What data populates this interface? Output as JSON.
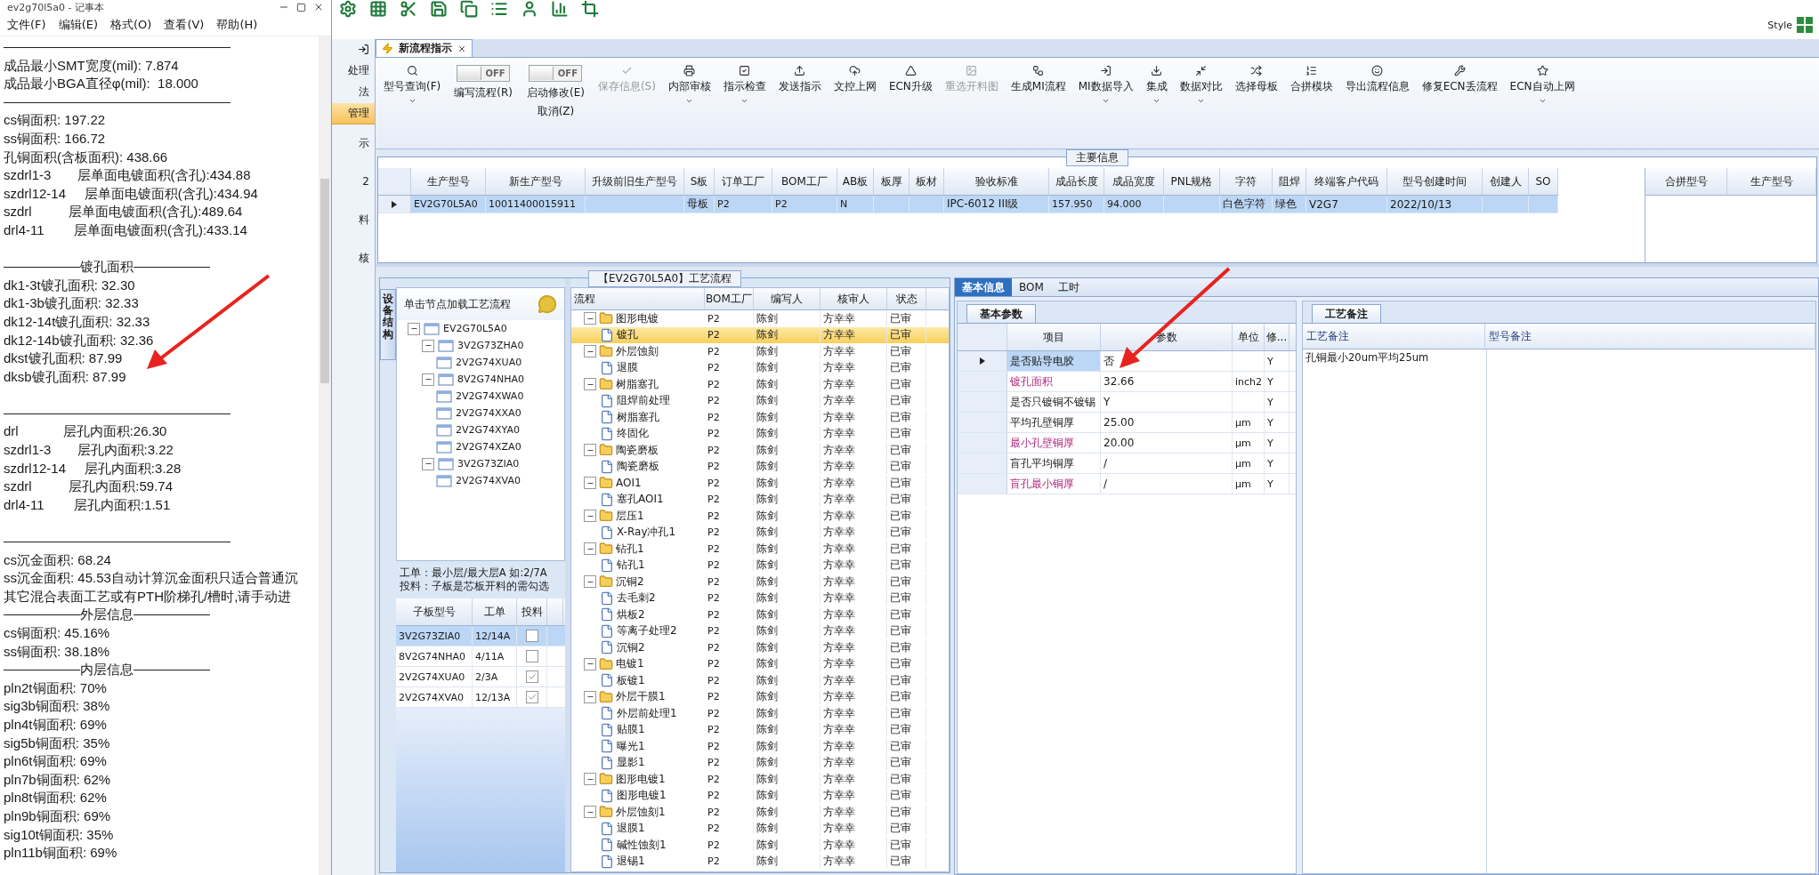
{
  "notepad": {
    "title": "ev2g70l5a0 - 记事本",
    "menu": [
      "文件(F)",
      "编辑(E)",
      "格式(O)",
      "查看(V)",
      "帮助(H)"
    ],
    "lines": [
      {
        "kind": "rule"
      },
      {
        "kind": "text",
        "text": "成品最小SMT宽度(mil): 7.874"
      },
      {
        "kind": "text",
        "text": "成品最小BGA直径φ(mil):  18.000"
      },
      {
        "kind": "rule"
      },
      {
        "kind": "text",
        "text": "cs铜面积: 197.22"
      },
      {
        "kind": "text",
        "text": "ss铜面积: 166.72"
      },
      {
        "kind": "text",
        "text": "孔铜面积(含板面积): 438.66"
      },
      {
        "kind": "text",
        "text": "szdrl1-3       层单面电镀面积(含孔):434.88"
      },
      {
        "kind": "text",
        "text": "szdrl12-14     层单面电镀面积(含孔):434.94"
      },
      {
        "kind": "text",
        "text": "szdrl          层单面电镀面积(含孔):489.64"
      },
      {
        "kind": "text",
        "text": "drl4-11        层单面电镀面积(含孔):433.14"
      },
      {
        "kind": "blank"
      },
      {
        "kind": "titled_rule",
        "text": "镀孔面积"
      },
      {
        "kind": "text",
        "text": "dk1-3t镀孔面积: 32.30"
      },
      {
        "kind": "text",
        "text": "dk1-3b镀孔面积: 32.33"
      },
      {
        "kind": "text",
        "text": "dk12-14t镀孔面积: 32.33"
      },
      {
        "kind": "text",
        "text": "dk12-14b镀孔面积: 32.36"
      },
      {
        "kind": "text",
        "text": "dkst镀孔面积: 87.99"
      },
      {
        "kind": "text",
        "text": "dksb镀孔面积: 87.99"
      },
      {
        "kind": "blank"
      },
      {
        "kind": "rule"
      },
      {
        "kind": "text",
        "text": "drl            层孔内面积:26.30"
      },
      {
        "kind": "text",
        "text": "szdrl1-3       层孔内面积:3.22"
      },
      {
        "kind": "text",
        "text": "szdrl12-14     层孔内面积:3.28"
      },
      {
        "kind": "text",
        "text": "szdrl          层孔内面积:59.74"
      },
      {
        "kind": "text",
        "text": "drl4-11        层孔内面积:1.51"
      },
      {
        "kind": "blank"
      },
      {
        "kind": "rule"
      },
      {
        "kind": "text",
        "text": "cs沉金面积: 68.24"
      },
      {
        "kind": "text",
        "text": "ss沉金面积: 45.53自动计算沉金面积只适合普通沉"
      },
      {
        "kind": "text",
        "text": "其它混合表面工艺或有PTH阶梯孔/槽时,请手动进"
      },
      {
        "kind": "titled_rule",
        "text": "外层信息"
      },
      {
        "kind": "text",
        "text": "cs铜面积: 45.16%"
      },
      {
        "kind": "text",
        "text": "ss铜面积: 38.18%"
      },
      {
        "kind": "titled_rule",
        "text": "内层信息"
      },
      {
        "kind": "text",
        "text": "pln2t铜面积: 70%"
      },
      {
        "kind": "text",
        "text": "sig3b铜面积: 38%"
      },
      {
        "kind": "text",
        "text": "pln4t铜面积: 69%"
      },
      {
        "kind": "text",
        "text": "sig5b铜面积: 35%"
      },
      {
        "kind": "text",
        "text": "pln6t铜面积: 69%"
      },
      {
        "kind": "text",
        "text": "pln7b铜面积: 62%"
      },
      {
        "kind": "text",
        "text": "pln8t铜面积: 62%"
      },
      {
        "kind": "text",
        "text": "pln9b铜面积: 69%"
      },
      {
        "kind": "text",
        "text": "sig10t铜面积: 35%"
      },
      {
        "kind": "text",
        "text": "pln11b铜面积: 69%"
      }
    ]
  },
  "app": {
    "top_bar": {
      "style_label": "Style"
    },
    "sidebar": [
      {
        "label": "处理",
        "selected": false
      },
      {
        "label": "法",
        "selected": false
      },
      {
        "label": "管理",
        "selected": true
      },
      {
        "label": "示",
        "selected": false
      },
      {
        "label": "2",
        "selected": false
      },
      {
        "label": "料",
        "selected": false
      },
      {
        "label": "核",
        "selected": false
      }
    ],
    "tab": {
      "label": "新流程指示",
      "selected": true
    },
    "ribbon": [
      {
        "kind": "button",
        "label": "型号查询(F)",
        "dropdown": true,
        "disabled": false
      },
      {
        "kind": "toggle",
        "label": "编写流程(R)",
        "state_text": "OFF",
        "on": false
      },
      {
        "kind": "toggle",
        "label": "启动修改(E)",
        "sublabel": "取消(Z)",
        "state_text": "OFF",
        "on": false
      },
      {
        "kind": "button",
        "label": "保存信息(S)",
        "dropdown": false,
        "disabled": true
      },
      {
        "kind": "button",
        "label": "内部审核",
        "dropdown": true,
        "disabled": false
      },
      {
        "kind": "button",
        "label": "指示检查",
        "dropdown": true,
        "disabled": false
      },
      {
        "kind": "button",
        "label": "发送指示",
        "dropdown": false,
        "disabled": false
      },
      {
        "kind": "button",
        "label": "文控上网",
        "dropdown": false,
        "disabled": false
      },
      {
        "kind": "button",
        "label": "ECN升级",
        "dropdown": false,
        "disabled": false
      },
      {
        "kind": "button",
        "label": "重选开料图",
        "dropdown": false,
        "disabled": true
      },
      {
        "kind": "button",
        "label": "生成MI流程",
        "dropdown": false,
        "disabled": false
      },
      {
        "kind": "button",
        "label": "MI数据导入",
        "dropdown": true,
        "disabled": false
      },
      {
        "kind": "button",
        "label": "集成",
        "dropdown": true,
        "disabled": false
      },
      {
        "kind": "button",
        "label": "数据对比",
        "dropdown": true,
        "disabled": false
      },
      {
        "kind": "button",
        "label": "选择母板",
        "dropdown": false,
        "disabled": false
      },
      {
        "kind": "button",
        "label": "合拼模块",
        "dropdown": false,
        "disabled": false
      },
      {
        "kind": "button",
        "label": "导出流程信息",
        "dropdown": false,
        "disabled": false
      },
      {
        "kind": "button",
        "label": "修复ECN丢流程",
        "dropdown": false,
        "disabled": false
      },
      {
        "kind": "button",
        "label": "ECN自动上网",
        "dropdown": true,
        "disabled": false
      }
    ],
    "main_info": {
      "title": "主要信息",
      "columns": [
        "生产型号",
        "新生产型号",
        "升级前旧生产型号",
        "S板",
        "订单工厂",
        "BOM工厂",
        "AB板",
        "板厚",
        "板材",
        "验收标准",
        "成品长度",
        "成品宽度",
        "PNL规格",
        "字符",
        "阻焊",
        "终端客户代码",
        "型号创建时间",
        "创建人",
        "SO"
      ],
      "rows": [
        {
          "current": true,
          "selected": true,
          "cells": [
            "EV2G70L5A0",
            "10011400015911",
            null,
            "母板",
            "P2",
            "P2",
            "N",
            null,
            null,
            "IPC-6012 III级",
            "157.950",
            "94.000",
            null,
            "白色字符",
            "绿色",
            "V2G7",
            "2022/10/13",
            null,
            null
          ]
        }
      ],
      "merge_columns": [
        "合拼型号",
        "生产型号"
      ]
    },
    "process": {
      "title": "【EV2G70L5A0】工艺流程",
      "side_tab": "设备结构",
      "tree_hint": "单击节点加载工艺流程",
      "tree": {
        "label": "EV2G70L5A0",
        "expanded": true,
        "children": [
          {
            "label": "3V2G73ZHA0",
            "expanded": true,
            "children": [
              {
                "label": "2V2G74XUA0"
              }
            ]
          },
          {
            "label": "8V2G74NHA0",
            "expanded": true,
            "children": [
              {
                "label": "2V2G74XWA0"
              },
              {
                "label": "2V2G74XXA0"
              },
              {
                "label": "2V2G74XYA0"
              },
              {
                "label": "2V2G74XZA0"
              }
            ]
          },
          {
            "label": "3V2G73ZIA0",
            "expanded": true,
            "children": [
              {
                "label": "2V2G74XVA0"
              }
            ]
          }
        ]
      },
      "notes": [
        "工单：最小层/最大层A 如:2/7A",
        "投料：子板是芯板开料的需勾选"
      ],
      "sub_grid": {
        "columns": [
          "子板型号",
          "工单",
          "投料"
        ],
        "rows": [
          {
            "cells": [
              "3V2G73ZIA0",
              "12/14A"
            ],
            "checked": false,
            "selected": true
          },
          {
            "cells": [
              "8V2G74NHA0",
              "4/11A"
            ],
            "checked": false,
            "selected": false
          },
          {
            "cells": [
              "2V2G74XUA0",
              "2/3A"
            ],
            "checked": true,
            "selected": false
          },
          {
            "cells": [
              "2V2G74XVA0",
              "12/13A"
            ],
            "checked": true,
            "selected": false
          }
        ]
      },
      "flow_grid": {
        "columns": [
          "流程",
          "BOM工厂",
          "编写人",
          "核审人",
          "状态"
        ],
        "rows": [
          {
            "name": "图形电镀",
            "bom": "P2",
            "writer": "陈剑",
            "reviewer": "方幸幸",
            "status": "已审",
            "selected": false,
            "expanded": true,
            "children": [
              {
                "name": "镀孔",
                "bom": "P2",
                "writer": "陈剑",
                "reviewer": "方幸幸",
                "status": "已审",
                "selected": true
              }
            ]
          },
          {
            "name": "外层蚀刻",
            "bom": "P2",
            "writer": "陈剑",
            "reviewer": "方幸幸",
            "status": "已审",
            "selected": false,
            "expanded": true,
            "children": [
              {
                "name": "退膜",
                "bom": "P2",
                "writer": "陈剑",
                "reviewer": "方幸幸",
                "status": "已审",
                "selected": false
              }
            ]
          },
          {
            "name": "树脂塞孔",
            "bom": "P2",
            "writer": "陈剑",
            "reviewer": "方幸幸",
            "status": "已审",
            "selected": false,
            "expanded": true,
            "children": [
              {
                "name": "阻焊前处理",
                "bom": "P2",
                "writer": "陈剑",
                "reviewer": "方幸幸",
                "status": "已审",
                "selected": false
              },
              {
                "name": "树脂塞孔",
                "bom": "P2",
                "writer": "陈剑",
                "reviewer": "方幸幸",
                "status": "已审",
                "selected": false
              },
              {
                "name": "终固化",
                "bom": "P2",
                "writer": "陈剑",
                "reviewer": "方幸幸",
                "status": "已审",
                "selected": false
              }
            ]
          },
          {
            "name": "陶瓷磨板",
            "bom": "P2",
            "writer": "陈剑",
            "reviewer": "方幸幸",
            "status": "已审",
            "selected": false,
            "expanded": true,
            "children": [
              {
                "name": "陶瓷磨板",
                "bom": "P2",
                "writer": "陈剑",
                "reviewer": "方幸幸",
                "status": "已审",
                "selected": false
              }
            ]
          },
          {
            "name": "AOI1",
            "bom": "P2",
            "writer": "陈剑",
            "reviewer": "方幸幸",
            "status": "已审",
            "selected": false,
            "expanded": true,
            "children": [
              {
                "name": "塞孔AOI1",
                "bom": "P2",
                "writer": "陈剑",
                "reviewer": "方幸幸",
                "status": "已审",
                "selected": false
              }
            ]
          },
          {
            "name": "层压1",
            "bom": "P2",
            "writer": "陈剑",
            "reviewer": "方幸幸",
            "status": "已审",
            "selected": false,
            "expanded": true,
            "children": [
              {
                "name": "X-Ray冲孔1",
                "bom": "P2",
                "writer": "陈剑",
                "reviewer": "方幸幸",
                "status": "已审",
                "selected": false
              }
            ]
          },
          {
            "name": "钻孔1",
            "bom": "P2",
            "writer": "陈剑",
            "reviewer": "方幸幸",
            "status": "已审",
            "selected": false,
            "expanded": true,
            "children": [
              {
                "name": "钻孔1",
                "bom": "P2",
                "writer": "陈剑",
                "reviewer": "方幸幸",
                "status": "已审",
                "selected": false
              }
            ]
          },
          {
            "name": "沉铜2",
            "bom": "P2",
            "writer": "陈剑",
            "reviewer": "方幸幸",
            "status": "已审",
            "selected": false,
            "expanded": true,
            "children": [
              {
                "name": "去毛刺2",
                "bom": "P2",
                "writer": "陈剑",
                "reviewer": "方幸幸",
                "status": "已审",
                "selected": false
              },
              {
                "name": "烘板2",
                "bom": "P2",
                "writer": "陈剑",
                "reviewer": "方幸幸",
                "status": "已审",
                "selected": false
              },
              {
                "name": "等离子处理2",
                "bom": "P2",
                "writer": "陈剑",
                "reviewer": "方幸幸",
                "status": "已审",
                "selected": false
              },
              {
                "name": "沉铜2",
                "bom": "P2",
                "writer": "陈剑",
                "reviewer": "方幸幸",
                "status": "已审",
                "selected": false
              }
            ]
          },
          {
            "name": "电镀1",
            "bom": "P2",
            "writer": "陈剑",
            "reviewer": "方幸幸",
            "status": "已审",
            "selected": false,
            "expanded": true,
            "children": [
              {
                "name": "板镀1",
                "bom": "P2",
                "writer": "陈剑",
                "reviewer": "方幸幸",
                "status": "已审",
                "selected": false
              }
            ]
          },
          {
            "name": "外层干膜1",
            "bom": "P2",
            "writer": "陈剑",
            "reviewer": "方幸幸",
            "status": "已审",
            "selected": false,
            "expanded": true,
            "children": [
              {
                "name": "外层前处理1",
                "bom": "P2",
                "writer": "陈剑",
                "reviewer": "方幸幸",
                "status": "已审",
                "selected": false
              },
              {
                "name": "贴膜1",
                "bom": "P2",
                "writer": "陈剑",
                "reviewer": "方幸幸",
                "status": "已审",
                "selected": false
              },
              {
                "name": "曝光1",
                "bom": "P2",
                "writer": "陈剑",
                "reviewer": "方幸幸",
                "status": "已审",
                "selected": false
              },
              {
                "name": "显影1",
                "bom": "P2",
                "writer": "陈剑",
                "reviewer": "方幸幸",
                "status": "已审",
                "selected": false
              }
            ]
          },
          {
            "name": "图形电镀1",
            "bom": "P2",
            "writer": "陈剑",
            "reviewer": "方幸幸",
            "status": "已审",
            "selected": false,
            "expanded": true,
            "children": [
              {
                "name": "图形电镀1",
                "bom": "P2",
                "writer": "陈剑",
                "reviewer": "方幸幸",
                "status": "已审",
                "selected": false
              }
            ]
          },
          {
            "name": "外层蚀刻1",
            "bom": "P2",
            "writer": "陈剑",
            "reviewer": "方幸幸",
            "status": "已审",
            "selected": false,
            "expanded": true,
            "children": [
              {
                "name": "退膜1",
                "bom": "P2",
                "writer": "陈剑",
                "reviewer": "方幸幸",
                "status": "已审",
                "selected": false
              },
              {
                "name": "碱性蚀刻1",
                "bom": "P2",
                "writer": "陈剑",
                "reviewer": "方幸幸",
                "status": "已审",
                "selected": false
              },
              {
                "name": "退锡1",
                "bom": "P2",
                "writer": "陈剑",
                "reviewer": "方幸幸",
                "status": "已审",
                "selected": false
              }
            ]
          }
        ]
      }
    },
    "detail": {
      "tabs": [
        {
          "label": "基本信息",
          "selected": true
        },
        {
          "label": "BOM",
          "selected": false
        },
        {
          "label": "工时",
          "selected": false
        }
      ],
      "params": {
        "tab": "基本参数",
        "columns": [
          "项目",
          "参数",
          "单位",
          "修..."
        ],
        "rows": [
          {
            "current": true,
            "highlighted": false,
            "cells": [
              "是否贴导电胶",
              "否",
              null,
              "Y"
            ]
          },
          {
            "current": false,
            "highlighted": true,
            "cells": [
              "镀孔面积",
              "32.66",
              "inch2",
              "Y"
            ]
          },
          {
            "current": false,
            "highlighted": false,
            "cells": [
              "是否只镀铜不镀锡",
              "Y",
              null,
              "Y"
            ]
          },
          {
            "current": false,
            "highlighted": false,
            "cells": [
              "平均孔壁铜厚",
              "25.00",
              "μm",
              "Y"
            ]
          },
          {
            "current": false,
            "highlighted": true,
            "cells": [
              "最小孔壁铜厚",
              "20.00",
              "μm",
              "Y"
            ]
          },
          {
            "current": false,
            "highlighted": false,
            "cells": [
              "盲孔平均铜厚",
              "/",
              "μm",
              "Y"
            ]
          },
          {
            "current": false,
            "highlighted": true,
            "cells": [
              "盲孔最小铜厚",
              "/",
              "μm",
              "Y"
            ]
          }
        ]
      },
      "remarks": {
        "tab": "工艺备注",
        "columns": [
          "工艺备注",
          "型号备注"
        ],
        "cells": [
          "孔铜最小20um平均25um"
        ]
      }
    }
  }
}
